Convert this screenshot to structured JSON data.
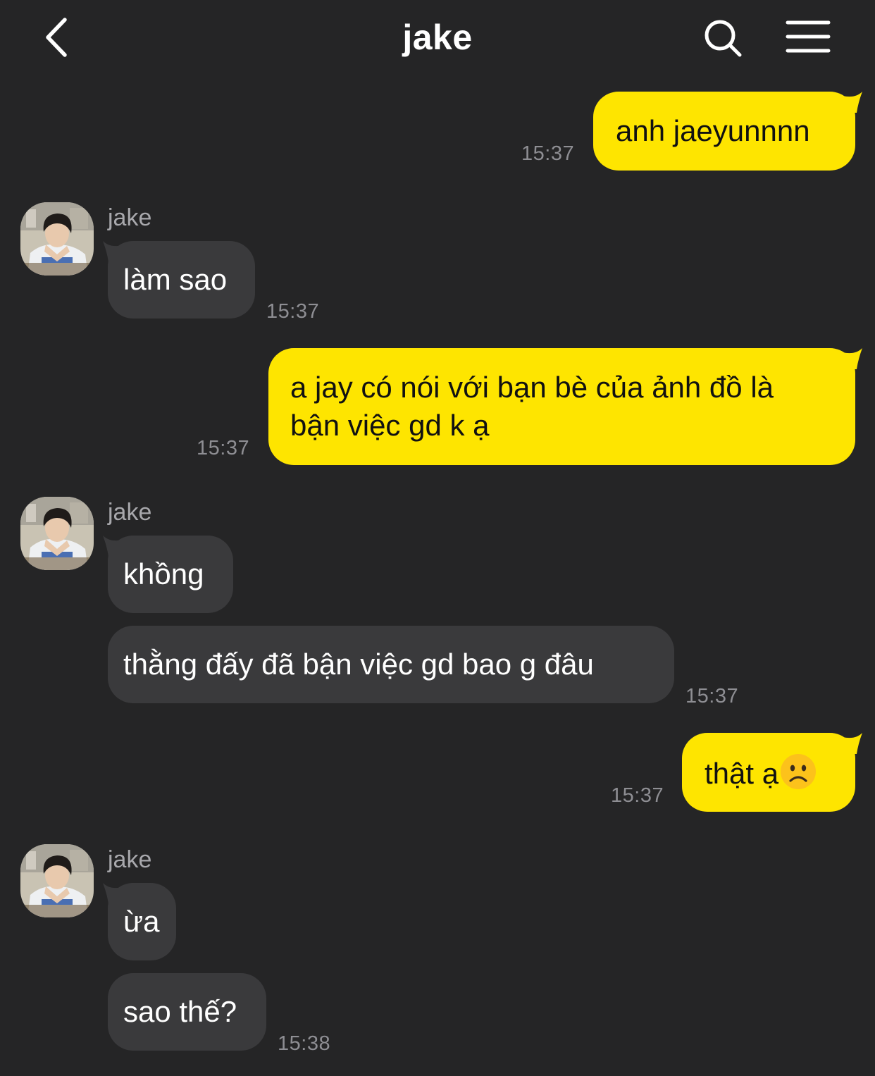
{
  "header": {
    "title": "jake",
    "icons": {
      "back": "chevron-left-icon",
      "search": "search-icon",
      "menu": "menu-icon"
    }
  },
  "colors": {
    "background": "#252526",
    "outgoing_bubble": "#fee500",
    "incoming_bubble": "#3a3a3c",
    "timestamp": "#8e8e93"
  },
  "messages": [
    {
      "direction": "out",
      "text": "anh jaeyunnnn",
      "time": "15:37"
    },
    {
      "direction": "in",
      "sender": "jake",
      "text": "làm sao",
      "time": "15:37"
    },
    {
      "direction": "out",
      "lines": [
        "a jay có nói với bạn bè của ảnh đồ là",
        "bận việc gd k ạ"
      ],
      "time": "15:37"
    },
    {
      "direction": "in",
      "sender": "jake",
      "text": "khồng"
    },
    {
      "direction": "in",
      "text": "thằng đấy đã bận việc gd bao g đâu",
      "time": "15:37"
    },
    {
      "direction": "out",
      "text": "thật ạ",
      "emoji": "frowning-face-emoji",
      "time": "15:37"
    },
    {
      "direction": "in",
      "sender": "jake",
      "text": "ừa"
    },
    {
      "direction": "in",
      "text": "sao thế?",
      "time": "15:38"
    }
  ]
}
